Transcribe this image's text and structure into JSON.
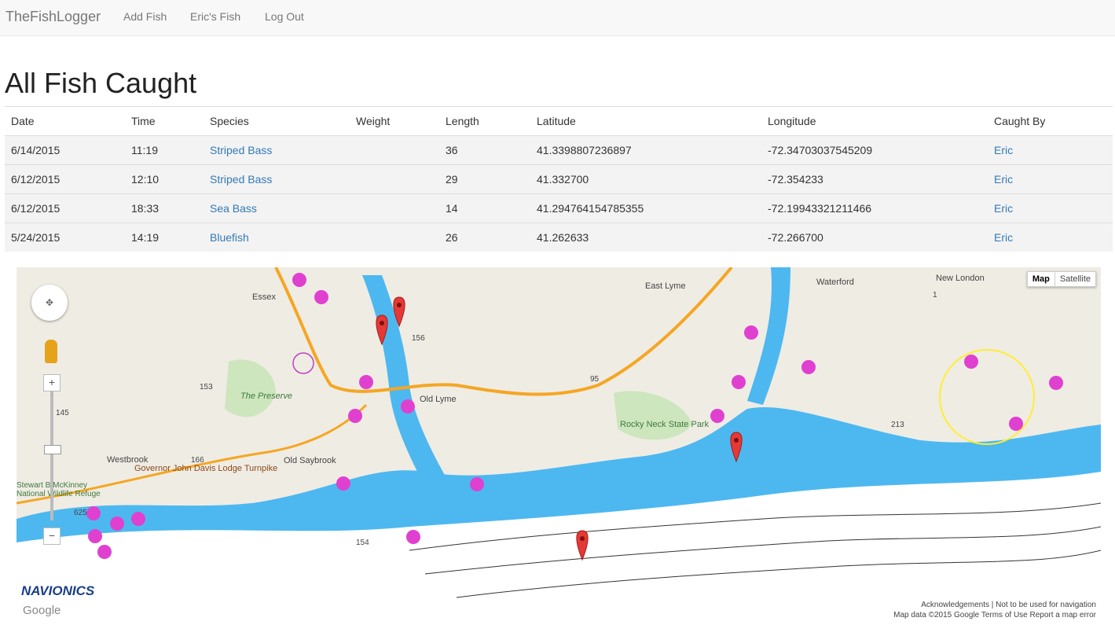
{
  "nav": {
    "brand": "TheFishLogger",
    "links": [
      "Add Fish",
      "Eric's Fish",
      "Log Out"
    ]
  },
  "page_title": "All Fish Caught",
  "table": {
    "headers": [
      "Date",
      "Time",
      "Species",
      "Weight",
      "Length",
      "Latitude",
      "Longitude",
      "Caught By"
    ],
    "rows": [
      {
        "date": "6/14/2015",
        "time": "11:19",
        "species": "Striped Bass",
        "weight": "",
        "length": "36",
        "latitude": "41.3398807236897",
        "longitude": "-72.34703037545209",
        "caught_by": "Eric"
      },
      {
        "date": "6/12/2015",
        "time": "12:10",
        "species": "Striped Bass",
        "weight": "",
        "length": "29",
        "latitude": "41.332700",
        "longitude": "-72.354233",
        "caught_by": "Eric"
      },
      {
        "date": "6/12/2015",
        "time": "18:33",
        "species": "Sea Bass",
        "weight": "",
        "length": "14",
        "latitude": "41.294764154785355",
        "longitude": "-72.19943321211466",
        "caught_by": "Eric"
      },
      {
        "date": "5/24/2015",
        "time": "14:19",
        "species": "Bluefish",
        "weight": "",
        "length": "26",
        "latitude": "41.262633",
        "longitude": "-72.266700",
        "caught_by": "Eric"
      }
    ]
  },
  "map": {
    "type_buttons": [
      "Map",
      "Satellite"
    ],
    "labels": [
      "Essex",
      "East Lyme",
      "Waterford",
      "New London",
      "The Preserve",
      "Old Lyme",
      "Westbrook",
      "Old Saybrook",
      "Rocky Neck State Park",
      "Governor John Davis Lodge Turnpike",
      "Stewart B McKinney National Wildlife Refuge",
      "95",
      "156",
      "153",
      "145",
      "166",
      "154",
      "213",
      "1",
      "625"
    ],
    "navionics_logo": "NAVIONICS",
    "google_logo": "Google",
    "attribution_line1": "Acknowledgements | Not to be used for navigation",
    "attribution_line2": "Map data ©2015 Google   Terms of Use   Report a map error",
    "water_color": "#4db8f0",
    "land_color": "#efece4",
    "highway_color": "#f5a623",
    "marker_color": "#e53935"
  }
}
